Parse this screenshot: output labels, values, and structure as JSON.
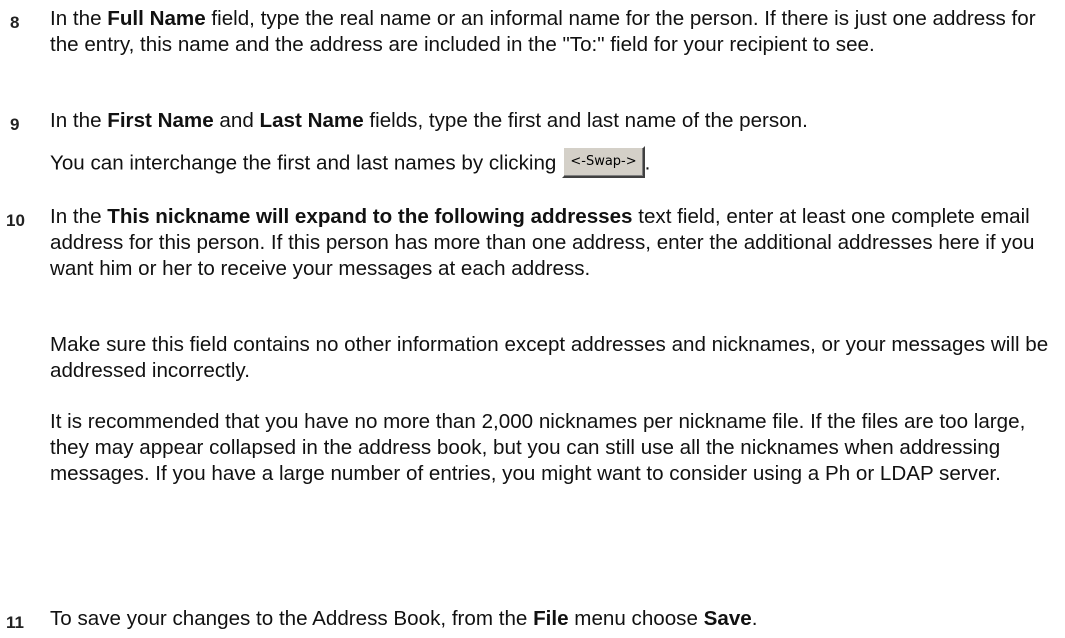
{
  "steps": [
    {
      "number": "8",
      "parts": {
        "p1": "In the ",
        "b1": "Full Name",
        "p2": " field, type the real name or an informal name for the person. If there is just one address for the entry, this name and the address are included in the \"To:\" field for your recipient to see."
      }
    },
    {
      "number": "9",
      "parts": {
        "p1": "In the ",
        "b1": "First Name",
        "p2": " and ",
        "b2": "Last Name",
        "p3": " fields, type the first and last name of the person."
      },
      "swap_line": {
        "before": "You can interchange the first and last names by clicking",
        "button_label": "<-Swap->",
        "after": "."
      }
    },
    {
      "number": "10",
      "parts": {
        "p1": "In the ",
        "b1": "This nickname will expand to the following addresses",
        "p2": " text field, enter at least one complete email address for this person. If this person has more than one address, enter the additional addresses here if you want him or her to receive your messages at each address."
      },
      "notes": [
        "Make sure this field contains no other information except addresses and nicknames, or your messages will be addressed incorrectly.",
        "It is recommended that you have no more than 2,000 nicknames per nickname file. If the files are too large, they may appear collapsed in the address book, but you can still use all the nicknames when addressing messages. If you have a large number of entries, you might want to consider using a Ph or LDAP server."
      ]
    },
    {
      "number": "11",
      "parts": {
        "p1": "To save your changes to the Address Book, from the ",
        "b1": "File",
        "p2": " menu choose ",
        "b2": "Save",
        "p3": "."
      }
    }
  ]
}
